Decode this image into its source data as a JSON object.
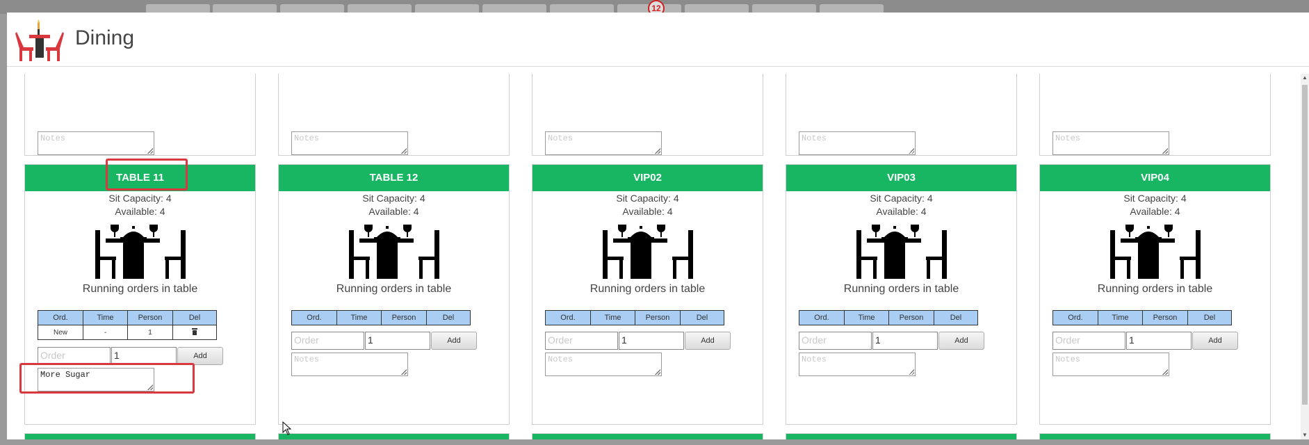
{
  "background": {
    "badge_count": "12"
  },
  "modal": {
    "title": "Dining",
    "logo_icon": "dining-table-icon"
  },
  "labels": {
    "sit_capacity": "Sit Capacity: 4",
    "available": "Available: 4",
    "running_orders": "Running orders in table",
    "notes_placeholder": "Notes",
    "order_placeholder": "Order",
    "add_button": "Add",
    "qty_default": "1"
  },
  "order_table": {
    "headers": [
      "Ord.",
      "Time",
      "Person",
      "Del"
    ]
  },
  "tables": [
    {
      "name": "TABLE 11",
      "rows": [
        {
          "ord": "New",
          "time": "-",
          "person": "1",
          "del_icon": "trash-icon"
        }
      ],
      "notes_value": "More Sugar"
    },
    {
      "name": "TABLE 12",
      "rows": [],
      "notes_value": ""
    },
    {
      "name": "VIP02",
      "rows": [],
      "notes_value": ""
    },
    {
      "name": "VIP03",
      "rows": [],
      "notes_value": ""
    },
    {
      "name": "VIP04",
      "rows": [],
      "notes_value": ""
    }
  ],
  "colors": {
    "header_green": "#18b663",
    "table_header_blue": "#a9cdf3",
    "highlight_red": "#d9393e"
  }
}
